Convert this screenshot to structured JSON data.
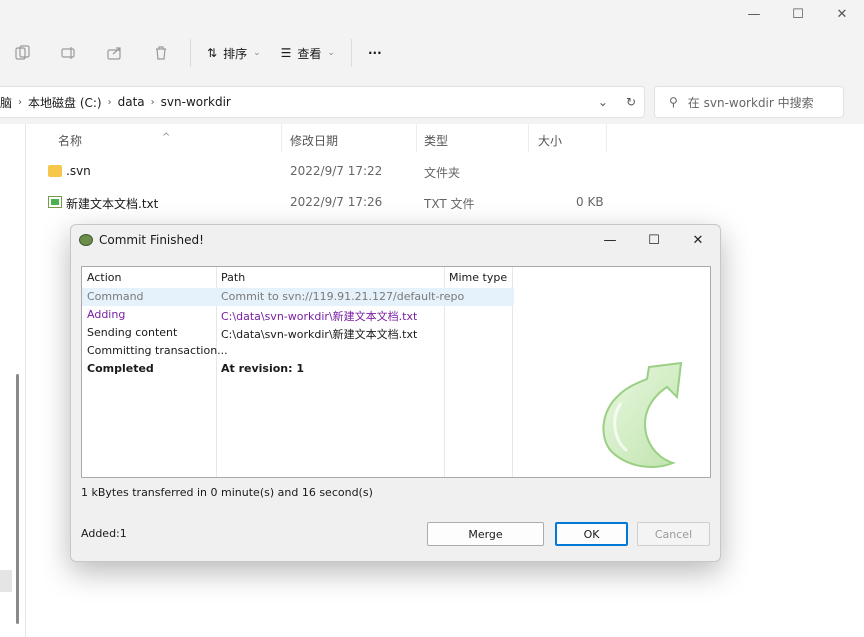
{
  "window": {
    "minimize": "—",
    "maximize": "☐",
    "close": "✕"
  },
  "toolbar": {
    "sort_label": "排序",
    "view_label": "查看",
    "more_label": "···"
  },
  "address": {
    "crumbs": [
      "脑",
      "本地磁盘 (C:)",
      "data",
      "svn-workdir"
    ],
    "search_placeholder": "在 svn-workdir 中搜索"
  },
  "files": {
    "columns": [
      "名称",
      "修改日期",
      "类型",
      "大小"
    ],
    "rows": [
      {
        "name": ".svn",
        "date": "2022/9/7 17:22",
        "type": "文件夹",
        "size": ""
      },
      {
        "name": "新建文本文档.txt",
        "date": "2022/9/7 17:26",
        "type": "TXT 文件",
        "size": "0 KB"
      }
    ]
  },
  "dialog": {
    "title": "Commit Finished!",
    "columns": [
      "Action",
      "Path",
      "Mime type"
    ],
    "rows": [
      {
        "action": "Command",
        "path": "Commit to svn://119.91.21.127/default-repo"
      },
      {
        "action": "Adding",
        "path": "C:\\data\\svn-workdir\\新建文本文档.txt"
      },
      {
        "action": "Sending content",
        "path": "C:\\data\\svn-workdir\\新建文本文档.txt"
      },
      {
        "action": "Committing transaction...",
        "path": ""
      },
      {
        "action": "Completed",
        "path": "At revision: 1"
      }
    ],
    "transfer_text": "1 kBytes transferred in 0 minute(s) and 16 second(s)",
    "added_text": "Added:1",
    "merge_label": "Merge",
    "ok_label": "OK",
    "cancel_label": "Cancel"
  }
}
